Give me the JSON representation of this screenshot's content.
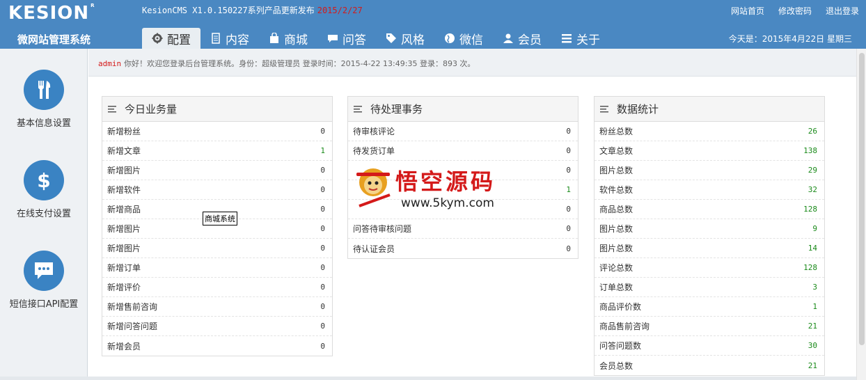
{
  "header": {
    "logo": "KESION",
    "logo_mark": "R",
    "release_text": "KesionCMS X1.0.150227系列产品更新发布",
    "release_date": "2015/2/27",
    "links": [
      "网站首页",
      "修改密码",
      "退出登录"
    ],
    "system_name": "微网站管理系统",
    "today": "今天是：2015年4月22日 星期三"
  },
  "nav": {
    "tabs": [
      {
        "label": "配置",
        "icon": "gear-icon"
      },
      {
        "label": "内容",
        "icon": "document-icon"
      },
      {
        "label": "商城",
        "icon": "bag-icon"
      },
      {
        "label": "问答",
        "icon": "chat-icon"
      },
      {
        "label": "风格",
        "icon": "tag-icon"
      },
      {
        "label": "微信",
        "icon": "globe-icon"
      },
      {
        "label": "会员",
        "icon": "user-icon"
      },
      {
        "label": "关于",
        "icon": "list-icon"
      }
    ]
  },
  "sidebar": {
    "items": [
      {
        "label": "基本信息设置",
        "icon": "tools-icon"
      },
      {
        "label": "在线支付设置",
        "icon": "dollar-icon"
      },
      {
        "label": "短信接口API配置",
        "icon": "sms-icon"
      }
    ]
  },
  "welcome": {
    "user": "admin",
    "text": "你好！欢迎您登录后台管理系统。身份：超级管理员 登录时间：2015-4-22 13:49:35 登录：893 次。"
  },
  "panels": {
    "today": {
      "title": "今日业务量",
      "rows": [
        {
          "label": "新增粉丝",
          "value": "0"
        },
        {
          "label": "新增文章",
          "value": "1"
        },
        {
          "label": "新增图片",
          "value": "0"
        },
        {
          "label": "新增软件",
          "value": "0"
        },
        {
          "label": "新增商品",
          "value": "0"
        },
        {
          "label": "新增图片",
          "value": "0"
        },
        {
          "label": "新增图片",
          "value": "0"
        },
        {
          "label": "新增订单",
          "value": "0"
        },
        {
          "label": "新增评价",
          "value": "0"
        },
        {
          "label": "新增售前咨询",
          "value": "0"
        },
        {
          "label": "新增问答问题",
          "value": "0"
        },
        {
          "label": "新增会员",
          "value": "0"
        }
      ]
    },
    "pending": {
      "title": "待处理事务",
      "rows": [
        {
          "label": "待审核评论",
          "value": "0"
        },
        {
          "label": "待发货订单",
          "value": "0"
        },
        {
          "label": "",
          "value": "0"
        },
        {
          "label": "",
          "value": "1"
        },
        {
          "label": "",
          "value": "0"
        },
        {
          "label": "问答待审核问题",
          "value": "0"
        },
        {
          "label": "待认证会员",
          "value": "0"
        }
      ]
    },
    "stats": {
      "title": "数据统计",
      "rows": [
        {
          "label": "粉丝总数",
          "value": "26"
        },
        {
          "label": "文章总数",
          "value": "138"
        },
        {
          "label": "图片总数",
          "value": "29"
        },
        {
          "label": "软件总数",
          "value": "32"
        },
        {
          "label": "商品总数",
          "value": "128"
        },
        {
          "label": "图片总数",
          "value": "9"
        },
        {
          "label": "图片总数",
          "value": "14"
        },
        {
          "label": "评论总数",
          "value": "128"
        },
        {
          "label": "订单总数",
          "value": "3"
        },
        {
          "label": "商品评价数",
          "value": "1"
        },
        {
          "label": "商品售前咨询",
          "value": "21"
        },
        {
          "label": "问答问题数",
          "value": "30"
        },
        {
          "label": "会员总数",
          "value": "21"
        }
      ]
    }
  },
  "tooltip": "商城系统",
  "watermark": {
    "title": "悟空源码",
    "url": "www.5kym.com"
  },
  "colors": {
    "header": "#4a88c2",
    "accent_red": "#d41a1a",
    "value_green": "#1a8a1a",
    "sidebar_circle": "#3a83c3"
  }
}
